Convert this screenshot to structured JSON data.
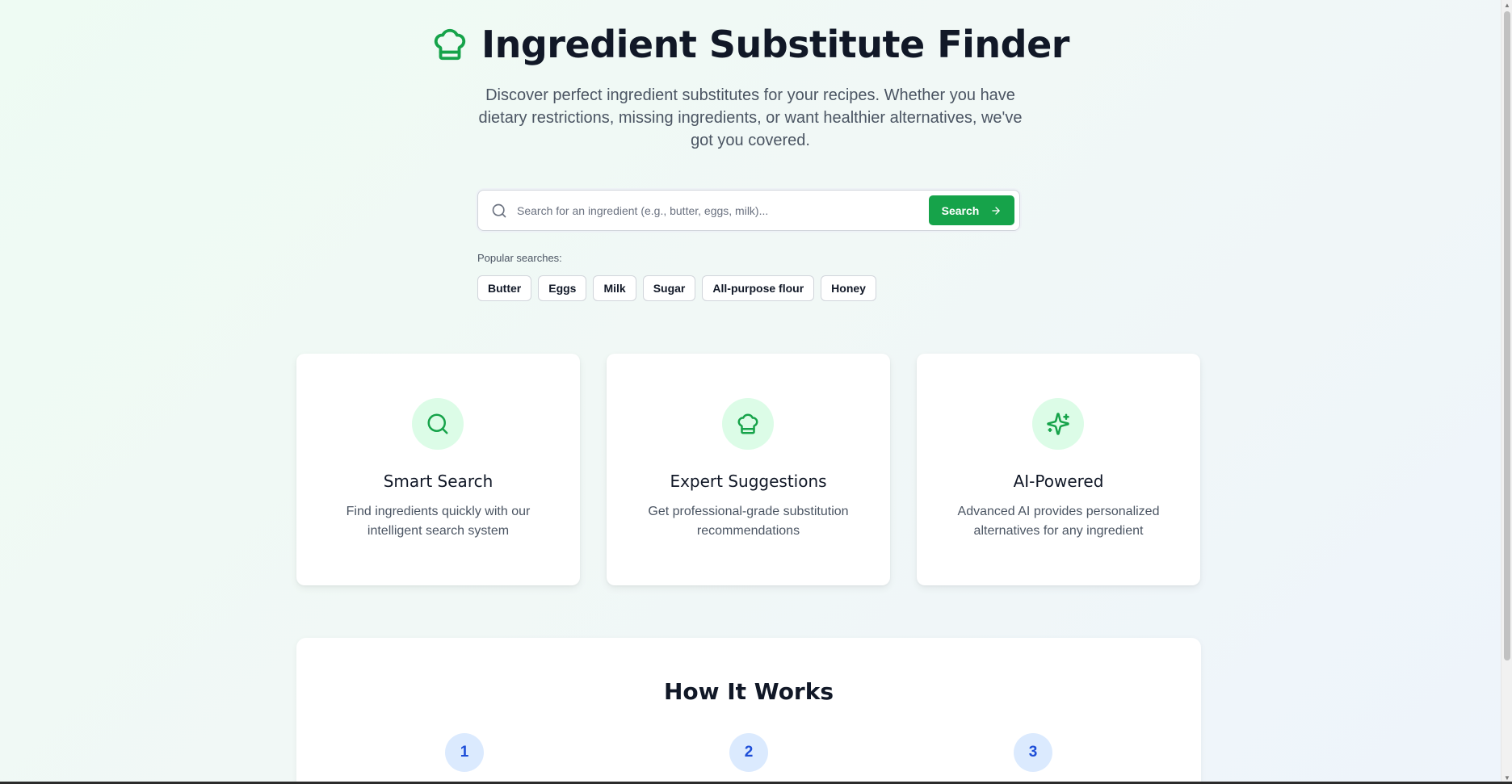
{
  "hero": {
    "title": "Ingredient Substitute Finder",
    "icon": "chef-hat-icon",
    "subtitle": "Discover perfect ingredient substitutes for your recipes. Whether you have dietary restrictions, missing ingredients, or want healthier alternatives, we've got you covered."
  },
  "search": {
    "placeholder": "Search for an ingredient (e.g., butter, eggs, milk)...",
    "value": "",
    "button_label": "Search"
  },
  "popular": {
    "label": "Popular searches:",
    "items": [
      "Butter",
      "Eggs",
      "Milk",
      "Sugar",
      "All-purpose flour",
      "Honey"
    ]
  },
  "features": [
    {
      "icon": "search-icon",
      "title": "Smart Search",
      "description": "Find ingredients quickly with our intelligent search system"
    },
    {
      "icon": "chef-hat-icon",
      "title": "Expert Suggestions",
      "description": "Get professional-grade substitution recommendations"
    },
    {
      "icon": "sparkles-icon",
      "title": "AI-Powered",
      "description": "Advanced AI provides personalized alternatives for any ingredient"
    }
  ],
  "how_it_works": {
    "title": "How It Works",
    "steps": [
      "1",
      "2",
      "3"
    ]
  },
  "colors": {
    "accent": "#16a34a",
    "accent_light": "#dcfce7",
    "step_bg": "#dbeafe",
    "step_text": "#1d4ed8"
  }
}
